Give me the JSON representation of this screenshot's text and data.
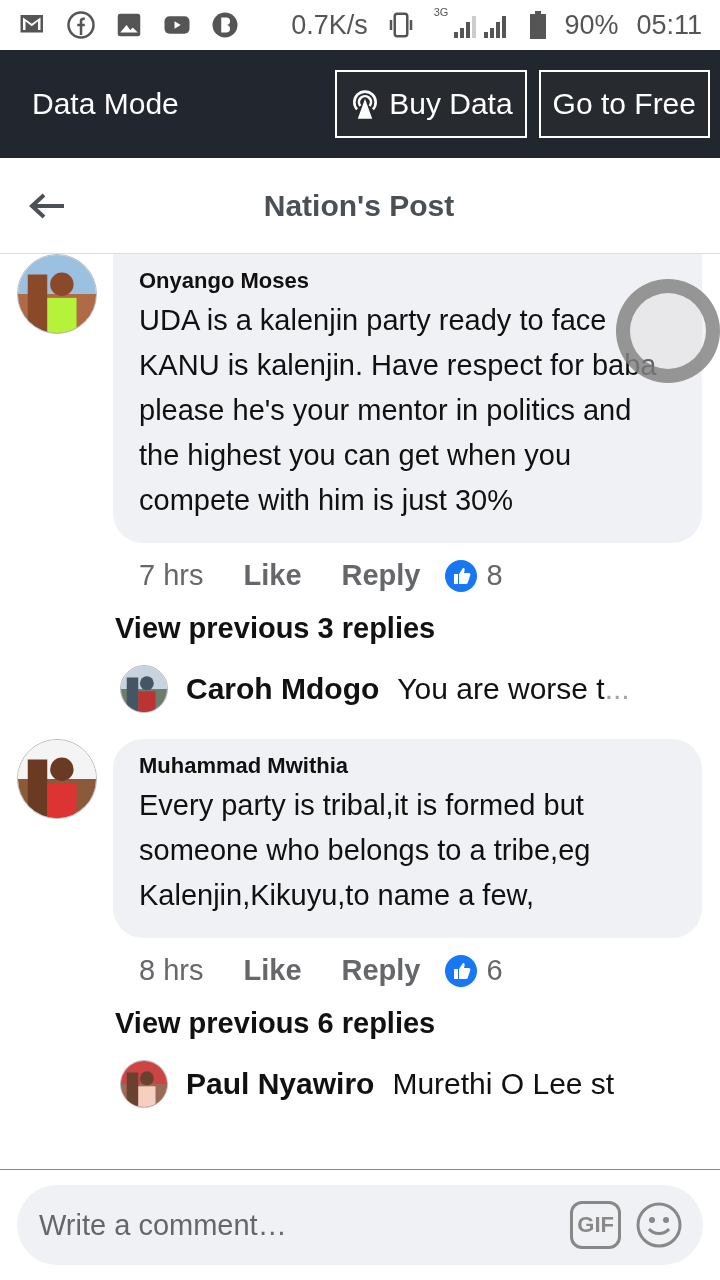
{
  "status_bar": {
    "speed": "0.7K/s",
    "network": "3G",
    "battery": "90%",
    "time": "05:11"
  },
  "data_bar": {
    "title": "Data Mode",
    "buttons": [
      "Buy Data",
      "Go to Free"
    ]
  },
  "header": {
    "title": "Nation's Post"
  },
  "items": [
    {
      "kind": "comment",
      "author": "Onyango Moses",
      "text": "UDA is a kalenjin party ready to face KANU is kalenjin. Have respect for baba please he's your mentor in politics and the highest you can get when you compete with him is just 30%",
      "time": "7 hrs",
      "like": "Like",
      "reply": "Reply",
      "reactions": "8"
    },
    {
      "kind": "link",
      "text": "View previous 3 replies"
    },
    {
      "kind": "reply",
      "author": "Caroh Mdogo",
      "text": "You are worse t",
      "ellipsis": "..."
    },
    {
      "kind": "comment",
      "author": "Muhammad Mwithia",
      "text": "Every party is tribal,it is formed but someone who belongs to a tribe,eg Kalenjin,Kikuyu,to name a few,",
      "time": "8 hrs",
      "like": "Like",
      "reply": "Reply",
      "reactions": "6"
    },
    {
      "kind": "link",
      "text": "View previous 6 replies"
    },
    {
      "kind": "reply",
      "author": "Paul Nyawiro",
      "text": "Murethi O Lee st"
    }
  ],
  "composer": {
    "placeholder": "Write a comment…",
    "gif": "GIF"
  }
}
